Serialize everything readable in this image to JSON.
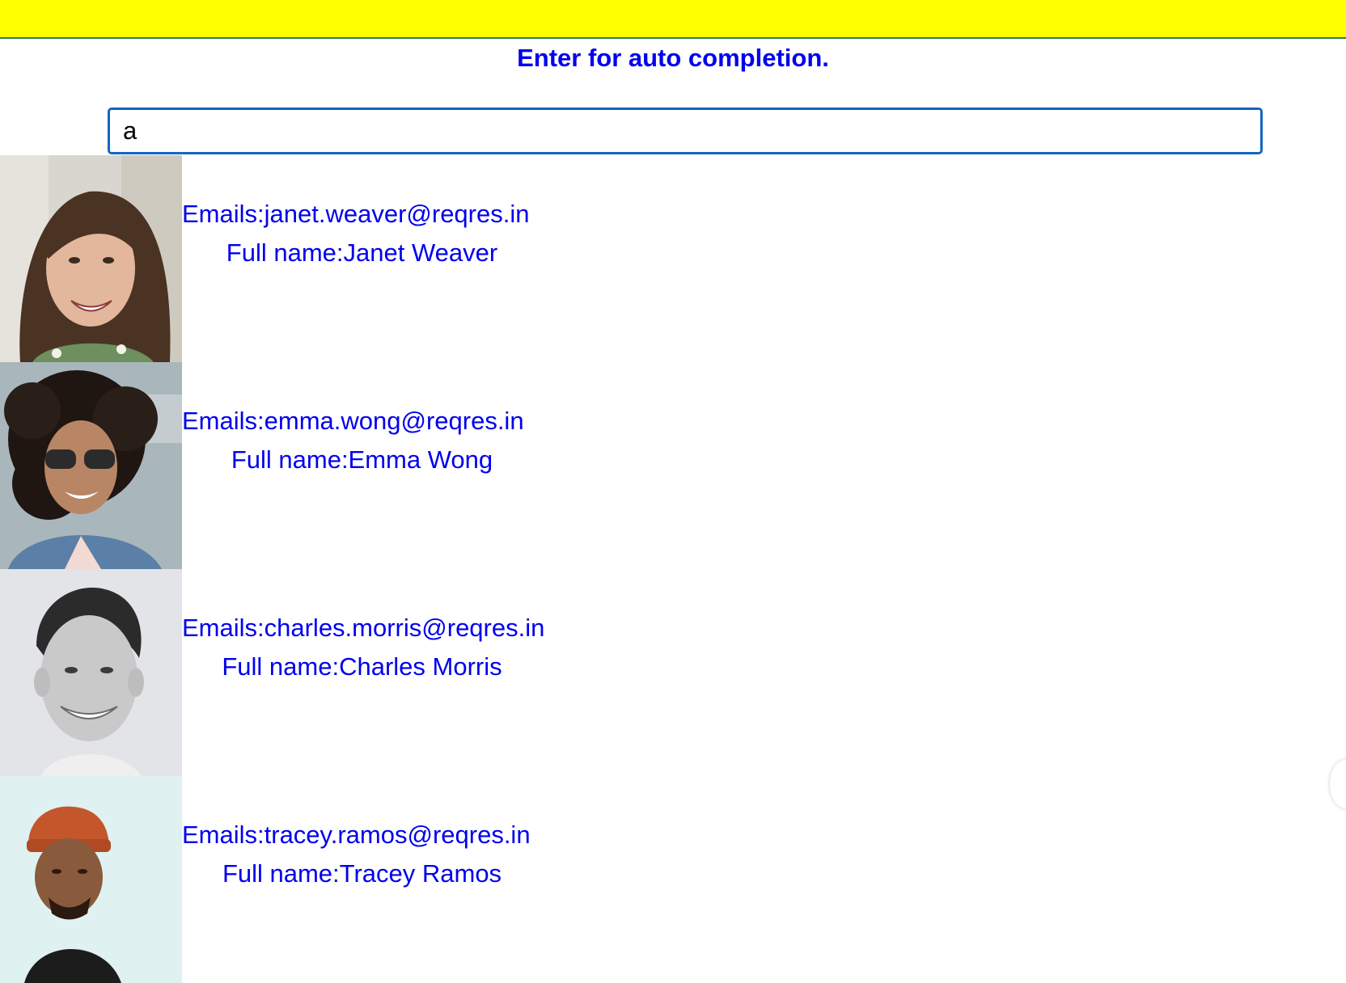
{
  "header": {
    "banner_color": "#ffff00",
    "title": "Enter for auto completion."
  },
  "search": {
    "value": "a",
    "placeholder": ""
  },
  "results": [
    {
      "email": "Emails:janet.weaver@reqres.in",
      "full_name": "Full name:Janet Weaver",
      "avatar_icon": "avatar-photo"
    },
    {
      "email": "Emails:emma.wong@reqres.in",
      "full_name": "Full name:Emma Wong",
      "avatar_icon": "avatar-photo"
    },
    {
      "email": "Emails:charles.morris@reqres.in",
      "full_name": "Full name:Charles Morris",
      "avatar_icon": "avatar-photo"
    },
    {
      "email": "Emails:tracey.ramos@reqres.in",
      "full_name": "Full name:Tracey Ramos",
      "avatar_icon": "avatar-photo"
    }
  ],
  "colors": {
    "text": "#0000ee",
    "input_border": "#1565c0",
    "banner_border": "#2e7d32"
  }
}
